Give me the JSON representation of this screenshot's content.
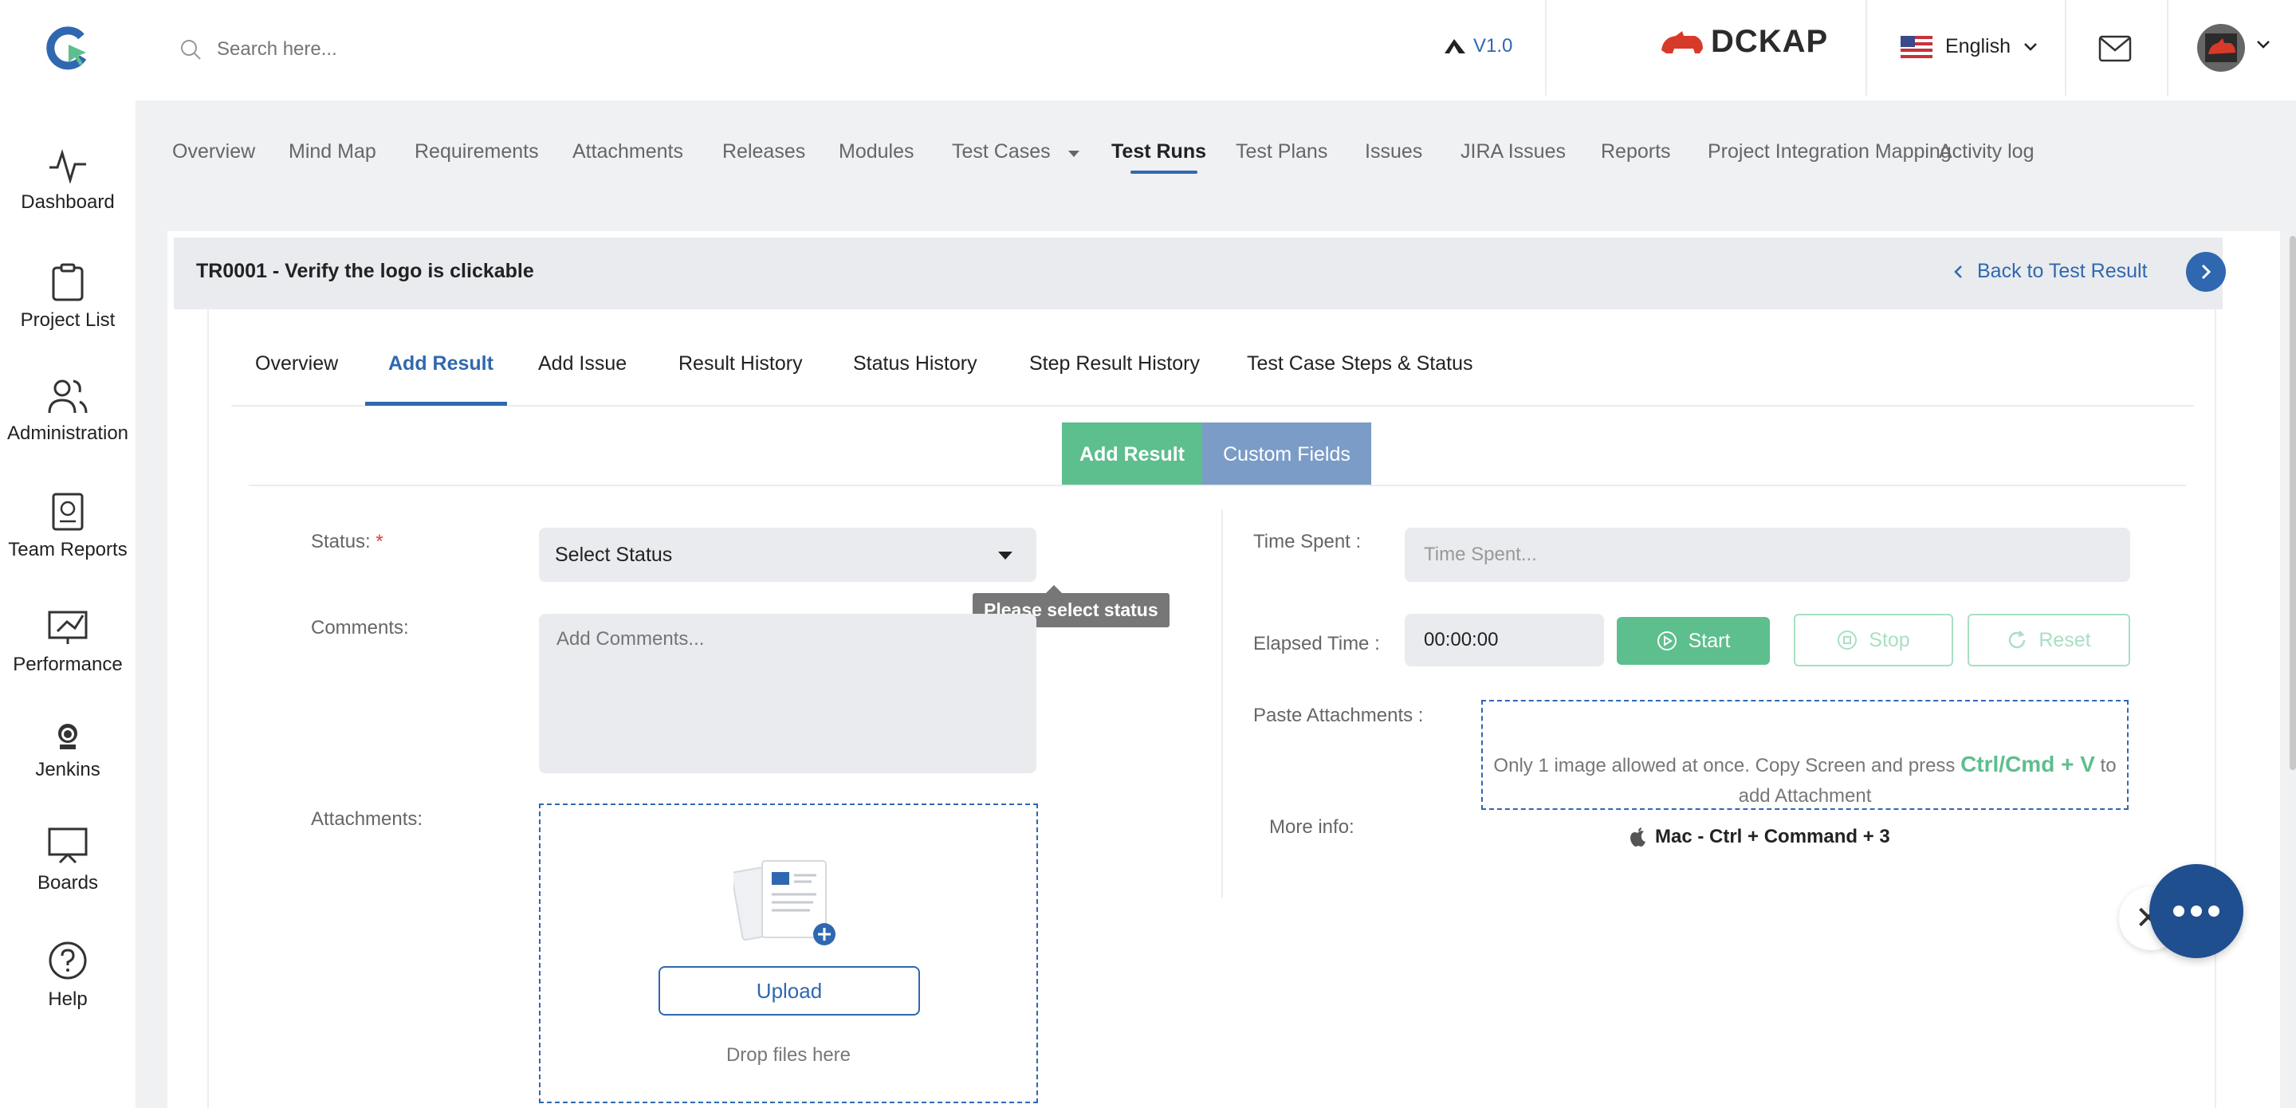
{
  "topbar": {
    "search_placeholder": "Search here...",
    "version": "V1.0",
    "brand": "DCKAP",
    "language": "English"
  },
  "sidebar": {
    "items": [
      {
        "label": "Dashboard",
        "icon": "pulse-icon"
      },
      {
        "label": "Project List",
        "icon": "clipboard-icon"
      },
      {
        "label": "Administration",
        "icon": "users-icon"
      },
      {
        "label": "Team Reports",
        "icon": "report-icon"
      },
      {
        "label": "Performance",
        "icon": "performance-icon"
      },
      {
        "label": "Jenkins",
        "icon": "jenkins-icon"
      },
      {
        "label": "Boards",
        "icon": "board-icon"
      },
      {
        "label": "Help",
        "icon": "help-icon"
      }
    ]
  },
  "project_nav": {
    "items": [
      "Overview",
      "Mind Map",
      "Requirements",
      "Attachments",
      "Releases",
      "Modules",
      "Test Cases",
      "Test Runs",
      "Test Plans",
      "Issues",
      "JIRA Issues",
      "Reports",
      "Project Integration Mapping",
      "Activity log"
    ],
    "active": "Test Runs"
  },
  "card": {
    "title": "TR0001 - Verify the logo is clickable",
    "back_label": "Back to Test Result"
  },
  "tabs": {
    "items": [
      "Overview",
      "Add Result",
      "Add Issue",
      "Result History",
      "Status History",
      "Step Result History",
      "Test Case Steps & Status"
    ],
    "active": "Add Result"
  },
  "segments": {
    "add_result": "Add Result",
    "custom_fields": "Custom Fields"
  },
  "form": {
    "status_label": "Status:",
    "status_required": "*",
    "status_value": "Select Status",
    "status_tooltip": "Please select status",
    "comments_label": "Comments:",
    "comments_placeholder": "Add Comments...",
    "attachments_label": "Attachments:",
    "upload_label": "Upload",
    "drop_text": "Drop files here",
    "time_spent_label": "Time Spent :",
    "time_spent_placeholder": "Time Spent...",
    "elapsed_label": "Elapsed Time :",
    "elapsed_value": "00:00:00",
    "start_label": "Start",
    "stop_label": "Stop",
    "reset_label": "Reset",
    "paste_label": "Paste Attachments :",
    "paste_text_before": "Only 1 image allowed at once. Copy Screen and press ",
    "paste_shortcut": "Ctrl/Cmd + V",
    "paste_text_after": " to add Attachment",
    "more_info_label": "More info:",
    "mac_info": "Mac - Ctrl + Command + 3"
  },
  "colors": {
    "primary": "#2f68b0",
    "success": "#5dbe8e",
    "segment_blue": "#7b9cc6",
    "floating": "#1f4f8e"
  }
}
